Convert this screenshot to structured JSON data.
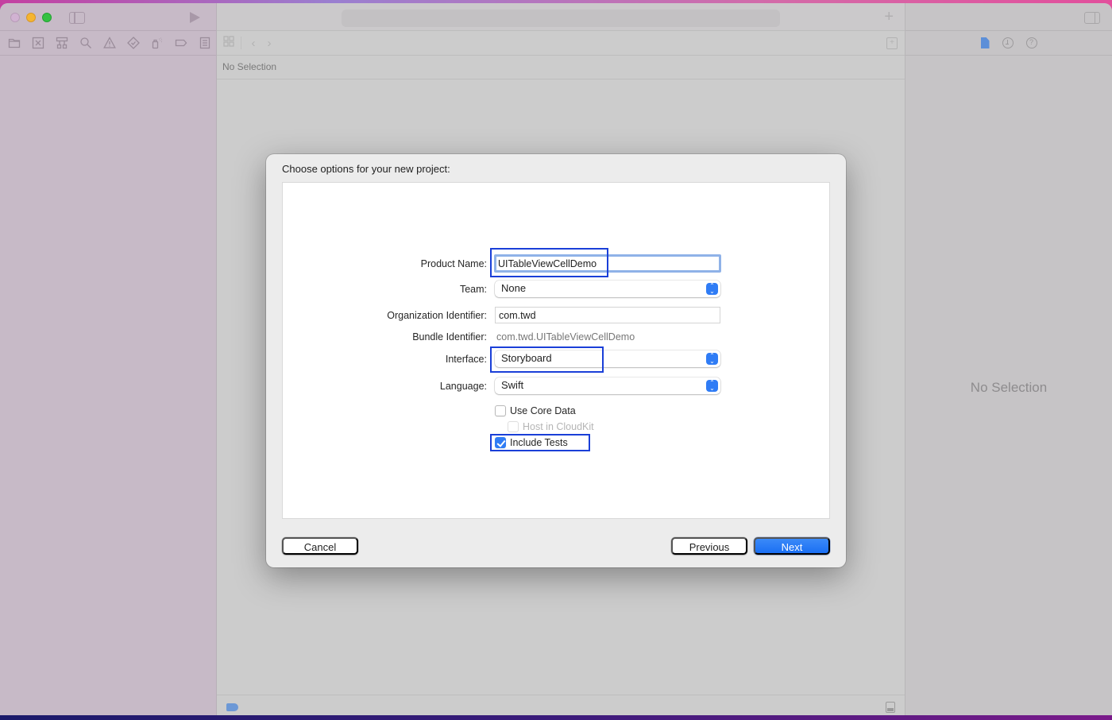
{
  "window": {
    "traffic_lights": [
      "close",
      "minimize",
      "zoom"
    ],
    "navigator_toolbar": [
      {
        "name": "project-navigator-icon",
        "glyph": "folder"
      },
      {
        "name": "source-control-navigator-icon",
        "glyph": "x-square"
      },
      {
        "name": "symbol-navigator-icon",
        "glyph": "hierarchy"
      },
      {
        "name": "find-navigator-icon",
        "glyph": "magnifier"
      },
      {
        "name": "issue-navigator-icon",
        "glyph": "warning"
      },
      {
        "name": "test-navigator-icon",
        "glyph": "diamond-check"
      },
      {
        "name": "debug-navigator-icon",
        "glyph": "spray"
      },
      {
        "name": "breakpoint-navigator-icon",
        "glyph": "tag"
      },
      {
        "name": "report-navigator-icon",
        "glyph": "list"
      }
    ]
  },
  "editor": {
    "jump_bar_text": "No Selection",
    "add_glyph": "+",
    "back_glyph": "‹",
    "forward_glyph": "›"
  },
  "inspector": {
    "empty_text": "No Selection",
    "help_glyph": "?"
  },
  "dialog": {
    "title": "Choose options for your new project:",
    "fields": {
      "product_name": {
        "label": "Product Name:",
        "value": "UITableViewCellDemo",
        "highlighted": true
      },
      "team": {
        "label": "Team:",
        "value": "None"
      },
      "organization_identifier": {
        "label": "Organization Identifier:",
        "value": "com.twd"
      },
      "bundle_identifier": {
        "label": "Bundle Identifier:",
        "value": "com.twd.UITableViewCellDemo"
      },
      "interface": {
        "label": "Interface:",
        "value": "Storyboard",
        "highlighted": true
      },
      "language": {
        "label": "Language:",
        "value": "Swift"
      }
    },
    "checkboxes": {
      "use_core_data": {
        "label": "Use Core Data",
        "checked": false,
        "enabled": true
      },
      "host_in_cloudkit": {
        "label": "Host in CloudKit",
        "checked": false,
        "enabled": false
      },
      "include_tests": {
        "label": "Include Tests",
        "checked": true,
        "enabled": true,
        "highlighted": true
      }
    },
    "buttons": {
      "cancel": "Cancel",
      "previous": "Previous",
      "next": "Next"
    },
    "stepper_up": "⌃",
    "stepper_down": "⌄"
  },
  "colors": {
    "accent": "#2f7cf5",
    "highlight_box": "#1a3fd8",
    "focus_ring": "#8fb2e8"
  }
}
